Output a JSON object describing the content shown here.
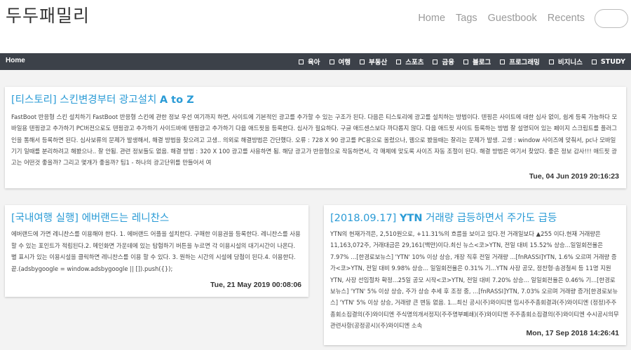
{
  "header": {
    "site_title": "두두패밀리",
    "links": [
      "Home",
      "Tags",
      "Guestbook",
      "Recents"
    ]
  },
  "nav": {
    "home": "Home",
    "items": [
      "육아",
      "여행",
      "부동산",
      "스포츠",
      "금융",
      "블로그",
      "프로그래밍",
      "비지니스",
      "STUDY"
    ]
  },
  "posts": [
    {
      "title_prefix": "[티스토리] 스킨변경부터 광고설치 ",
      "title_bold": "A to Z",
      "excerpt": "  FastBoot 반응형 스킨 설치하기   FastBoot 반응형 스킨에 관한 정보     우선 여기까지 하면, 사이트에 기본적인 광고를 추가할 수 있는 구조가 된다.   다음은 티스토리에 광고를 설치하는 방법이다.   텐핑은 사이트에 대한 심사 없이, 쉽게 등록 가능하다   모바일용 텐핑광고 추가하기   PC버전으로도 텐핑광고 추가하기   사이드바에 텐핑광고 추가하기     다음 애드핏을 등록한다.   심사가 필요하다. 구글 애드센스보다 까다롭지 않다.   다음 애드핏 사이트   등록하는 방법 잘 설명되어 있는 페이지   스크립트를 플러그인을 통해서 등록하면 된다.       심사보류의 문제가 발생해서, 해결 방법을 찾으려고 고생..   의외로 해결방법은 간단했다.   오류 : 728 X 90 광고를 PC용으로 올렸으나, 웹으로 봤을때는 잘리는 문제가 발생.   고생 : window 사이즈에 맞춰서, pc나 모바일 기기 일때를 분리하려고 해봤으나.. 잘 안됨.   관련 정보들도 없음.   해결 방법 : 320 X 100 광고를 사용하면 됨. 해당 광고가 반응형으로 작동하면서, 각 매체에 맞도록 사이즈 자동 조절이 된다.   해결 방법은 여기서 찾았다. 좋은 정보 감사!!!   애드핏 광고는 어떤것 좋을까? 그리고 몇개가 좋을까?   팁1 - 하나의 광고단위를 만들어서 여",
      "date": "Tue, 04 Jun 2019 20:16:23"
    },
    {
      "title_prefix": "[국내여행 실행] 에버랜드는 레니찬스",
      "title_bold": "",
      "excerpt": "에버랜드에 가면 레니찬스를 이용해야 한다. 1. 에버랜드 어플을 설치한다. 구매한 이용권을 등록한다. 레니찬스를 사용 할 수 있는 포인트가 적립된다.2. 메인화면 가운데에 있는 탐험하기 버튼을 누르면 각 이용시설의 대기시간이 나온다. 별 표시가 있는 이용시설을 클릭하면 레니찬스를 이용 할 수 있다.   3. 원하는 시간의 시설에 당첨이 된다.4. 이용한다. 끝.(adsbygoogle = window.adsbygoogle || []).push({});",
      "date": "Tue, 21 May 2019 00:08:06"
    },
    {
      "title_prefix": "[2018.09.17] ",
      "title_bold": "YTN",
      "title_suffix": " 거래량 급등하면서 주가도 급등",
      "excerpt": "YTN의 현재가격은, 2,510원으로, +11.31%의 흐름을 보이고 있다.전 거래일보다 ▲255 이다.현재 거래량은 11,163,072주, 거래대금은 29,161(백만)이다.최신 뉴스<코>YTN, 전일 대비 15.52% 상승...일일회전율은 7.97% ...[한경로보뉴스] 'YTN' 10% 이상 상승, 개장 직후 전일 거래량 ...[fnRASSI]YTN, 1.6% 오르며 거래량 증가<코>YTN, 전일 대비 9.98% 상승... 일일회전율은 0.31% 기...YTN 사장 공모, 정찬형·송경철씨 등 11명 지원YTN, 사장 선임절차 확정...25일 공모 시작<코>YTN, 전일 대비 7.20% 상승... 일일회전율은 0.46% 기...[한경로보뉴스] 'YTN' 5% 이상 상승, 주가 상승 추세 후 조정 중, ...[fnRASSI]YTN, 7.03% 오르며 거래량 증가[한경로보뉴스] 'YTN' 5% 이상 상승, 거래량 큰 변동 없음. 1...최신 공시(주)와이티엔 임시주주총회결과(주)와이티엔 (정정)주주총회소집결의(주)와이티엔 주식명의개서정지(주주명부폐쇄)(주)와이티엔 주주총회소집결의(주)와이티엔 수시공시의무관련사항(공정공시)(주)와이티엔 소속",
      "date": "Mon, 17 Sep 2018 14:26:41"
    }
  ],
  "colors": {
    "title": "#2a9bd6",
    "navbar": "#3c4149",
    "background": "#f3f3f3"
  }
}
